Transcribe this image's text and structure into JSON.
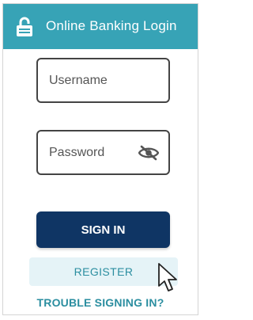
{
  "header": {
    "title": "Online Banking Login",
    "background_color": "#37a3b6",
    "icon": "lock-icon"
  },
  "form": {
    "username_placeholder": "Username",
    "password_placeholder": "Password",
    "password_toggle_icon": "eye-slash-icon",
    "sign_in_label": "SIGN IN",
    "sign_in_color": "#0f3564",
    "register_label": "REGISTER",
    "register_bg": "#e5f3f7",
    "trouble_link": "TROUBLE SIGNING IN?",
    "link_color": "#2b8ea0"
  },
  "cursor": {
    "icon": "mouse-pointer-icon"
  }
}
